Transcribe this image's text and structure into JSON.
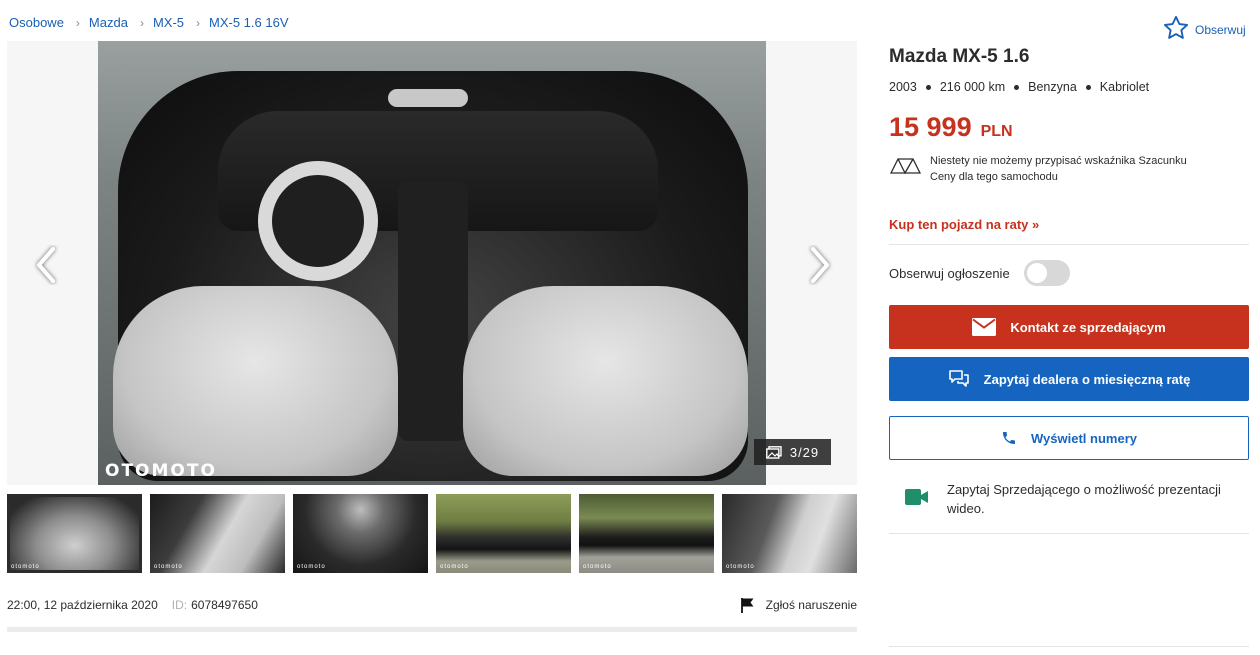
{
  "breadcrumb": [
    "Osobowe",
    "Mazda",
    "MX-5",
    "MX-5 1.6 16V"
  ],
  "watch_top_label": "Obserwuj",
  "gallery": {
    "watermark": "OTOMOTO",
    "counter": "3/29",
    "thumb_watermark": "otomoto"
  },
  "meta": {
    "date": "22:00, 12 października 2020",
    "id_label": "ID:",
    "id_value": "6078497650",
    "report_label": "Zgłoś naruszenie"
  },
  "listing": {
    "title": "Mazda MX-5 1.6",
    "year": "2003",
    "mileage": "216 000 km",
    "fuel": "Benzyna",
    "body": "Kabriolet",
    "price": "15 999",
    "currency": "PLN",
    "price_eval_line1": "Niestety nie możemy przypisać wskaźnika Szacunku",
    "price_eval_line2": "Ceny dla tego samochodu"
  },
  "actions": {
    "loan_link": "Kup ten pojazd na raty »",
    "follow_label": "Obserwuj ogłoszenie",
    "follow_on": false,
    "contact_button": "Kontakt ze sprzedającym",
    "dealer_button": "Zapytaj dealera o miesięczną ratę",
    "phone_button": "Wyświetl numery",
    "video_text": "Zapytaj Sprzedającego o możliwość prezentacji wideo."
  },
  "colors": {
    "link": "#1a5fb4",
    "accent_red": "#c6321e",
    "accent_blue": "#1565c0",
    "video_icon": "#1f8f6b"
  }
}
